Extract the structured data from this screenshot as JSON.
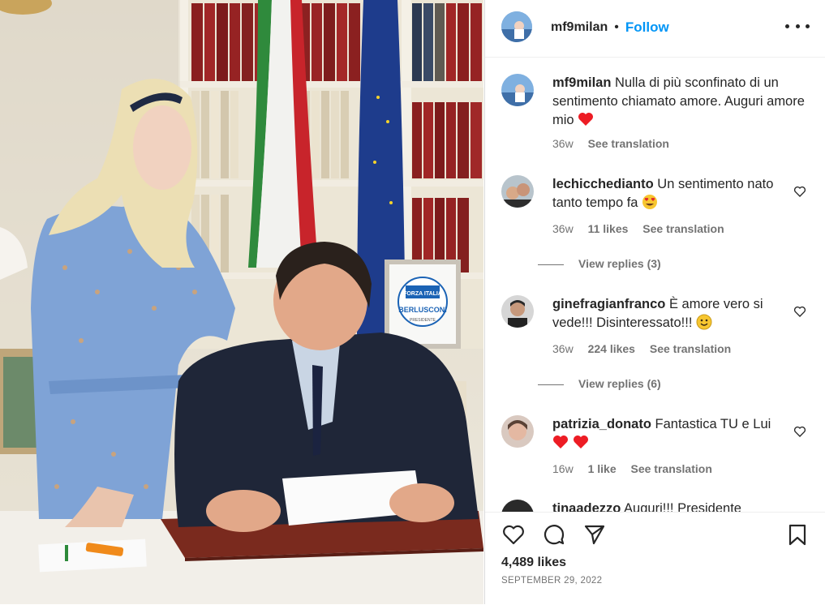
{
  "post": {
    "username": "mf9milan",
    "follow_label": "Follow",
    "separator": "•",
    "caption_username": "mf9milan",
    "caption_text": "Nulla di più sconfinato di un sentimento chiamato amore. Auguri amore mio",
    "caption_time": "36w",
    "caption_translate": "See translation"
  },
  "photo": {
    "poster_top": "FORZA ITALIA",
    "poster_name": "BERLUSCONI",
    "poster_sub": "PRESIDENTE"
  },
  "comments": [
    {
      "username": "lechicchedianto",
      "text": "Un sentimento nato tanto tempo fa",
      "time": "36w",
      "likes": "11 likes",
      "translate": "See translation",
      "replies": "View replies (3)"
    },
    {
      "username": "ginefragianfranco",
      "text": "È amore vero si vede!!! Disinteressato!!!",
      "time": "36w",
      "likes": "224 likes",
      "translate": "See translation",
      "replies": "View replies (6)"
    },
    {
      "username": "patrizia_donato",
      "text": "Fantastica TU e Lui",
      "time": "16w",
      "likes": "1 like",
      "translate": "See translation"
    },
    {
      "username_partial": "tinaadezzo",
      "text_partial": "Auguri!!! Presidente"
    }
  ],
  "footer": {
    "likes": "4,489 likes",
    "date": "SEPTEMBER 29, 2022"
  },
  "colors": {
    "accent": "#0095f6",
    "text": "#262626",
    "muted": "#737373",
    "heart": "#ed1c24"
  },
  "icons": [
    "like-icon",
    "comment-icon",
    "share-icon",
    "save-icon",
    "more-icon"
  ]
}
